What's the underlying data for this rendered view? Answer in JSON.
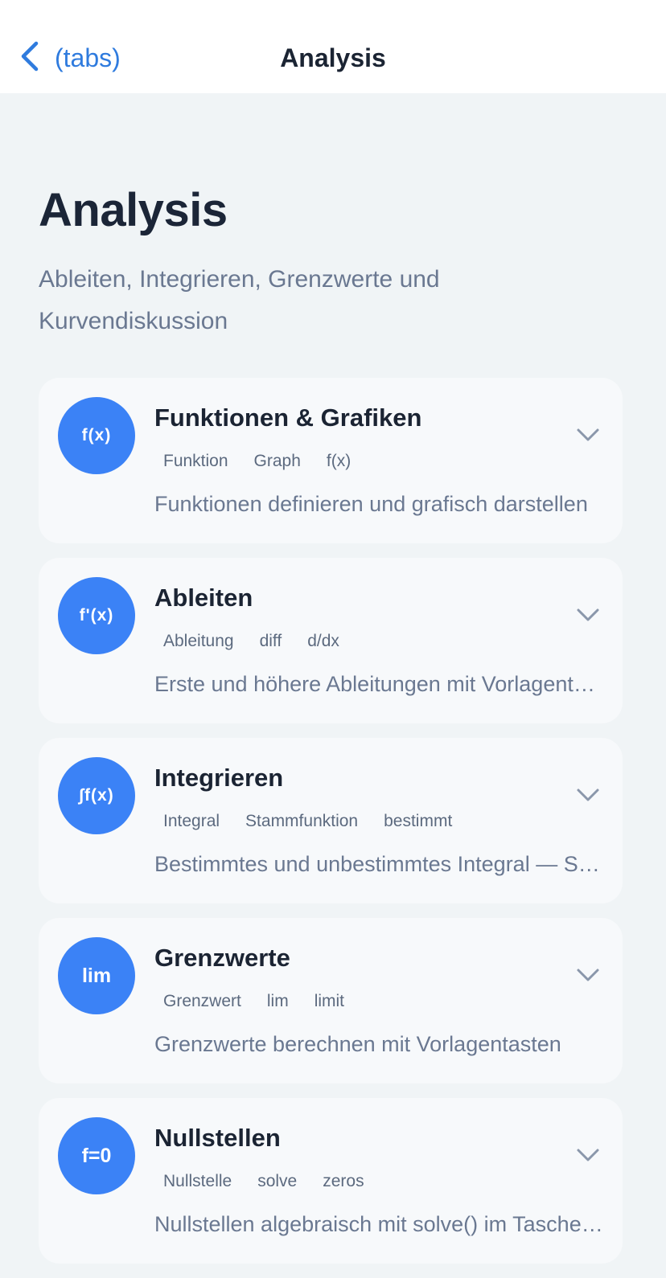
{
  "nav": {
    "back_label": "(tabs)",
    "title": "Analysis"
  },
  "header": {
    "title": "Analysis",
    "subtitle": "Ableiten, Integrieren, Grenzwerte und Kurvendiskussion"
  },
  "colors": {
    "accent": "#3b82f6",
    "link": "#2f7bde"
  },
  "cards": [
    {
      "icon": "f(x)",
      "title": "Funktionen & Grafiken",
      "tags": [
        "Funktion",
        "Graph",
        "f(x)"
      ],
      "description": "Funktionen definieren und grafisch darstellen"
    },
    {
      "icon": "f'(x)",
      "title": "Ableiten",
      "tags": [
        "Ableitung",
        "diff",
        "d/dx"
      ],
      "description": "Erste und höhere Ableitungen mit Vorlagentasten"
    },
    {
      "icon": "∫f(x)",
      "title": "Integrieren",
      "tags": [
        "Integral",
        "Stammfunktion",
        "bestimmt"
      ],
      "description": "Bestimmtes und unbestimmtes Integral — Schritt für Schritt"
    },
    {
      "icon": "lim",
      "title": "Grenzwerte",
      "tags": [
        "Grenzwert",
        "lim",
        "limit"
      ],
      "description": "Grenzwerte berechnen mit Vorlagentasten"
    },
    {
      "icon": "f=0",
      "title": "Nullstellen",
      "tags": [
        "Nullstelle",
        "solve",
        "zeros"
      ],
      "description": "Nullstellen algebraisch mit solve() im Taschenrechner"
    }
  ]
}
